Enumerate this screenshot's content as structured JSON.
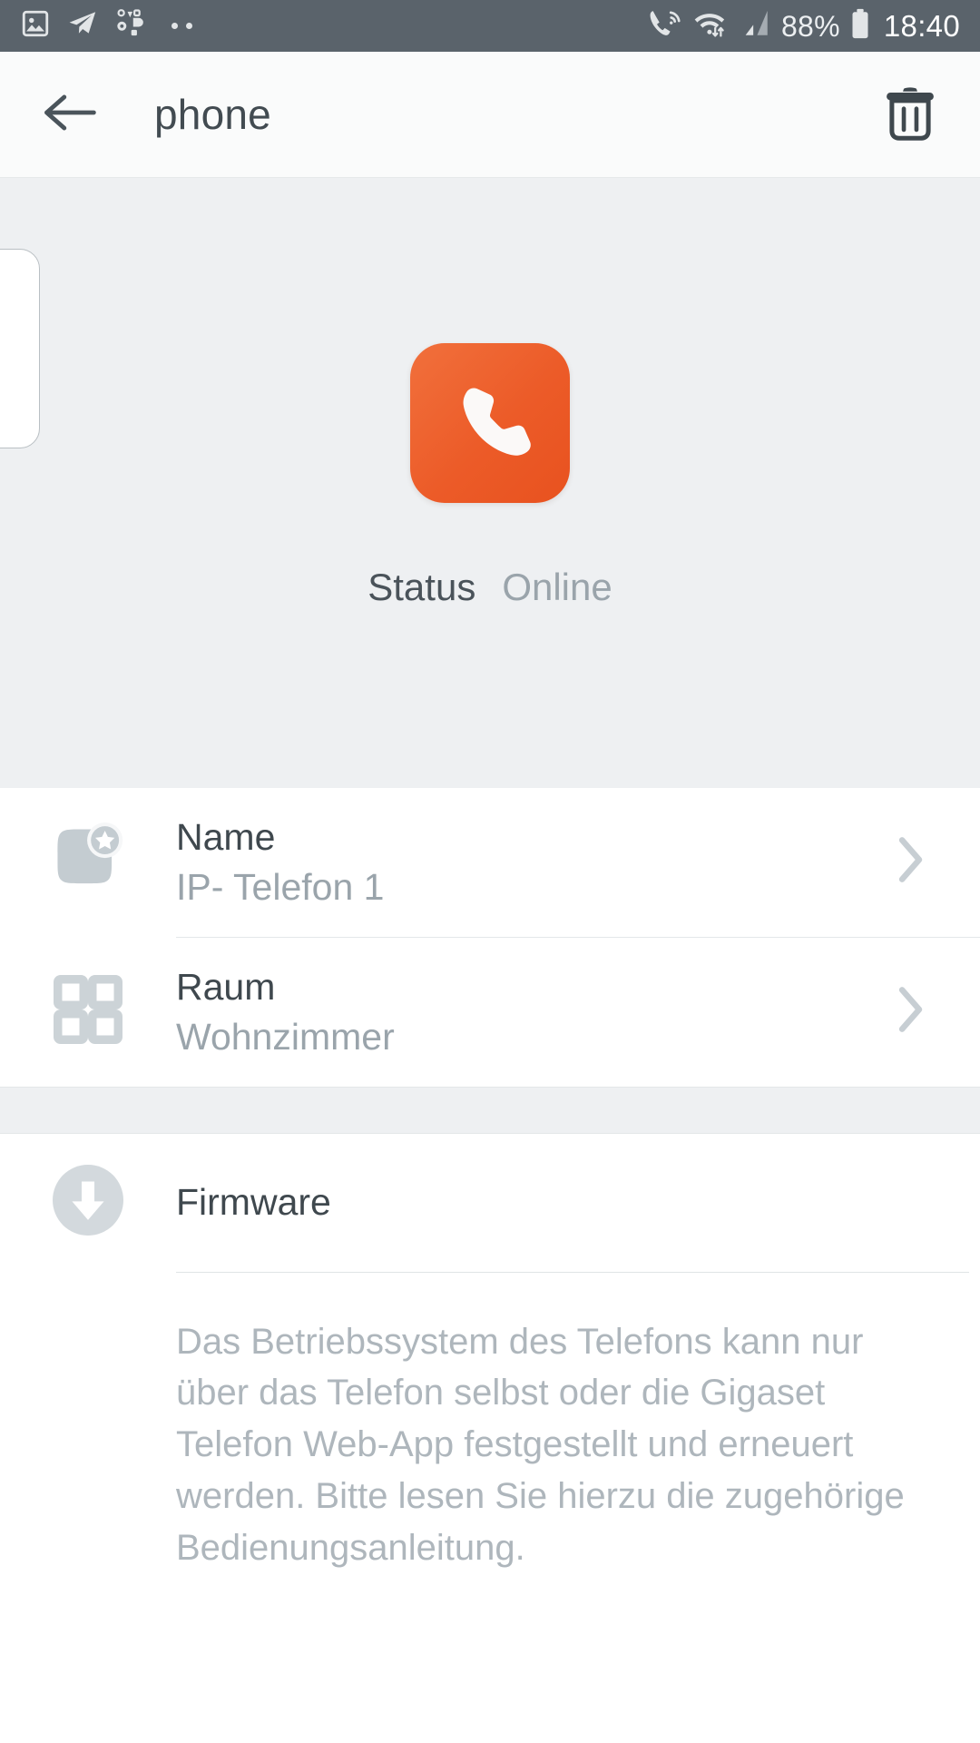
{
  "status_bar": {
    "left_icons": [
      "image-icon",
      "telegram-icon",
      "shapes-icon"
    ],
    "dots": [
      "dot",
      "dot"
    ],
    "right_icons": [
      "wifi-calling-icon",
      "wifi-data-icon",
      "cell-signal-icon",
      "battery-icon"
    ],
    "battery_percent": "88%",
    "time": "18:40",
    "background_color": "#5a636b",
    "foreground_color": "#eceff1"
  },
  "toolbar": {
    "back_icon": "arrow-left-icon",
    "title": "phone",
    "delete_icon": "trash-icon",
    "background_color": "#fafbfb",
    "title_color": "#424b51"
  },
  "hero": {
    "background_color": "#eef0f2",
    "app_icon": {
      "name": "phone-handset-icon",
      "color_start": "#f1703c",
      "color_end": "#e8521f"
    },
    "status_label": "Status",
    "status_value": "Online",
    "status_value_color": "#9aa4ab"
  },
  "settings": {
    "rows": [
      {
        "icon": "name-badge-star-icon",
        "title": "Name",
        "subtitle": "IP- Telefon 1",
        "chevron": "chevron-right-icon"
      },
      {
        "icon": "grid-rooms-icon",
        "title": "Raum",
        "subtitle": "Wohnzimmer",
        "chevron": "chevron-right-icon"
      }
    ]
  },
  "firmware": {
    "icon": "download-circle-icon",
    "title": "Firmware",
    "note": "Das Betriebssystem des Telefons kann nur über das Telefon selbst oder die Gigaset Telefon Web-App festgestellt und erneuert werden. Bitte lesen Sie hierzu die zugehörige Bedienungsanleitung.",
    "note_color": "#aeb6bc"
  }
}
